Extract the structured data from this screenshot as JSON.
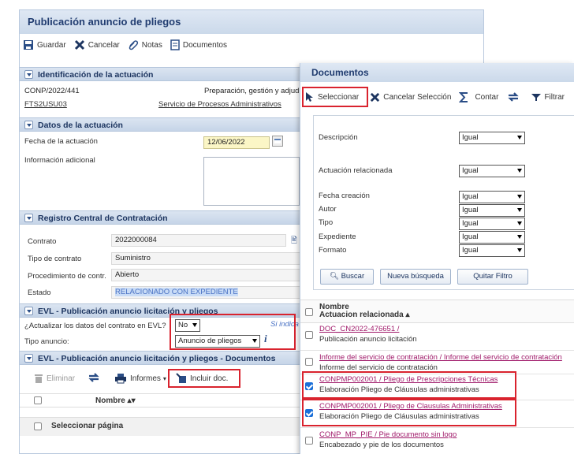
{
  "left": {
    "title": "Publicación anuncio de pliegos",
    "toolbar": {
      "save": "Guardar",
      "cancel": "Cancelar",
      "notes": "Notas",
      "documents": "Documentos"
    },
    "sec1": {
      "title": "Identificación de la actuación",
      "code": "CONP/2022/441",
      "desc": "Preparación, gestión y adjudicación",
      "user": "FTS2USU03",
      "service": "Servicio de Procesos Administrativos"
    },
    "sec2": {
      "title": "Datos de la actuación",
      "date_label": "Fecha de la actuación",
      "date_value": "12/06/2022",
      "info_label": "Información adicional"
    },
    "sec3": {
      "title": "Registro Central de Contratación",
      "contrato_label": "Contrato",
      "contrato_value": "2022000084",
      "tipo_label": "Tipo de contrato",
      "tipo_value": "Suministro",
      "proc_label": "Procedimiento de contr.",
      "proc_value": "Abierto",
      "estado_label": "Estado",
      "estado_value": "RELACIONADO CON EXPEDIENTE"
    },
    "sec4": {
      "title": "EVL - Publicación anuncio licitación y pliegos",
      "actualizar_label": "¿Actualizar los datos del contrato en EVL?",
      "actualizar_value": "No",
      "hint": "Si indica",
      "tipo_anuncio_label": "Tipo anuncio:",
      "tipo_anuncio_value": "Anuncio de pliegos"
    },
    "sec5": {
      "title": "EVL - Publicación anuncio licitación y pliegos - Documentos",
      "eliminar": "Eliminar",
      "informes": "Informes",
      "incluir": "Incluir doc.",
      "col_nombre": "Nombre",
      "select_page": "Seleccionar página"
    }
  },
  "right": {
    "title": "Documentos",
    "toolbar": {
      "select": "Seleccionar",
      "cancel_sel": "Cancelar Selección",
      "count": "Contar",
      "filter": "Filtrar"
    },
    "filters": [
      {
        "label": "Descripción",
        "value": "Igual"
      },
      {
        "label": "Actuación relacionada",
        "value": "Igual"
      },
      {
        "label": "Fecha creación",
        "value": "Igual"
      },
      {
        "label": "Autor",
        "value": "Igual"
      },
      {
        "label": "Tipo",
        "value": "Igual"
      },
      {
        "label": "Expediente",
        "value": "Igual"
      },
      {
        "label": "Formato",
        "value": "Igual"
      }
    ],
    "buttons": {
      "search": "Buscar",
      "new_search": "Nueva búsqueda",
      "remove_filter": "Quitar Filtro"
    },
    "list_header": {
      "col1": "Nombre",
      "col2": "Actuacion relacionada"
    },
    "docs": [
      {
        "title": "DOC_CN2022-476651 /",
        "sub": "Publicación anuncio licitación"
      },
      {
        "title": "Informe del servicio de contratación / Informe del servicio de contratación",
        "sub": "Informe del servicio de contratación"
      },
      {
        "title": "CONPMP002001 / Pliego de Prescripciones Técnicas",
        "sub": "Elaboración Pliego de Cláusulas administrativas"
      },
      {
        "title": "CONPMP002001 / Pliego de Clausulas Administrativas",
        "sub": "Elaboración Pliego de Cláusulas administrativas"
      },
      {
        "title": "CONP_MP_PIE / Pie documento sin logo",
        "sub": "Encabezado y pie de los documentos"
      }
    ]
  }
}
